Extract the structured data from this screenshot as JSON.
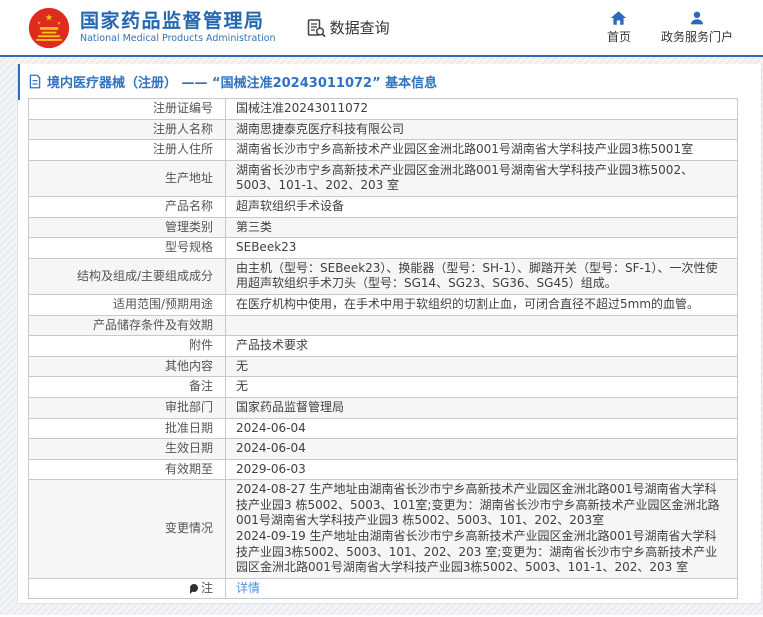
{
  "header": {
    "agency_name": "国家药品监督管理局",
    "agency_name_en": "National Medical Products Administration",
    "section_title": "数据查询",
    "nav": [
      {
        "label": "首页",
        "icon": "home-icon"
      },
      {
        "label": "政务服务门户",
        "icon": "user-icon"
      }
    ]
  },
  "breadcrumb": {
    "text": "境内医疗器械（注册） —— “国械注准20243011072” 基本信息"
  },
  "colors": {
    "accent_blue": "#2e6db4",
    "title_blue": "#2567ae",
    "breadcrumb_blue": "#3072c2",
    "link_blue": "#4a90e2",
    "emblem_red": "#dd2b1c",
    "emblem_gold": "#f5c518",
    "row_alt_bg": "#f6f6f7",
    "table_border": "#c9c9c9"
  },
  "table": {
    "rows": [
      {
        "label": "注册证编号",
        "value": "国械注准20243011072"
      },
      {
        "label": "注册人名称",
        "value": "湖南思捷泰克医疗科技有限公司"
      },
      {
        "label": "注册人住所",
        "value": "湖南省长沙市宁乡高新技术产业园区金洲北路001号湖南省大学科技产业园3栋5001室"
      },
      {
        "label": "生产地址",
        "value": "湖南省长沙市宁乡高新技术产业园区金洲北路001号湖南省大学科技产业园3栋5002、5003、101-1、202、203 室"
      },
      {
        "label": "产品名称",
        "value": "超声软组织手术设备"
      },
      {
        "label": "管理类别",
        "value": "第三类"
      },
      {
        "label": "型号规格",
        "value": "SEBeek23"
      },
      {
        "label": "结构及组成/主要组成成分",
        "value": "由主机（型号：SEBeek23）、换能器（型号：SH-1）、脚踏开关（型号：SF-1）、一次性使用超声软组织手术刀头（型号：SG14、SG23、SG36、SG45）组成。"
      },
      {
        "label": "适用范围/预期用途",
        "value": "在医疗机构中使用，在手术中用于软组织的切割止血，可闭合直径不超过5mm的血管。"
      },
      {
        "label": "产品储存条件及有效期",
        "value": ""
      },
      {
        "label": "附件",
        "value": "产品技术要求"
      },
      {
        "label": "其他内容",
        "value": "无"
      },
      {
        "label": "备注",
        "value": "无"
      },
      {
        "label": "审批部门",
        "value": "国家药品监督管理局"
      },
      {
        "label": "批准日期",
        "value": "2024-06-04"
      },
      {
        "label": "生效日期",
        "value": "2024-06-04"
      },
      {
        "label": "有效期至",
        "value": "2029-06-03"
      },
      {
        "label": "变更情况",
        "value": "2024-08-27 生产地址由湖南省长沙市宁乡高新技术产业园区金洲北路001号湖南省大学科技产业园3 栋5002、5003、101室;变更为：湖南省长沙市宁乡高新技术产业园区金洲北路001号湖南省大学科技产业园3 栋5002、5003、101、202、203室\n2024-09-19 生产地址由湖南省长沙市宁乡高新技术产业园区金洲北路001号湖南省大学科技产业园3栋5002、5003、101、202、203 室;变更为：湖南省长沙市宁乡高新技术产业园区金洲北路001号湖南省大学科技产业园3栋5002、5003、101-1、202、203 室"
      },
      {
        "label": "注",
        "icon": "note-balloon-icon",
        "value": "详情",
        "link": true
      }
    ]
  }
}
